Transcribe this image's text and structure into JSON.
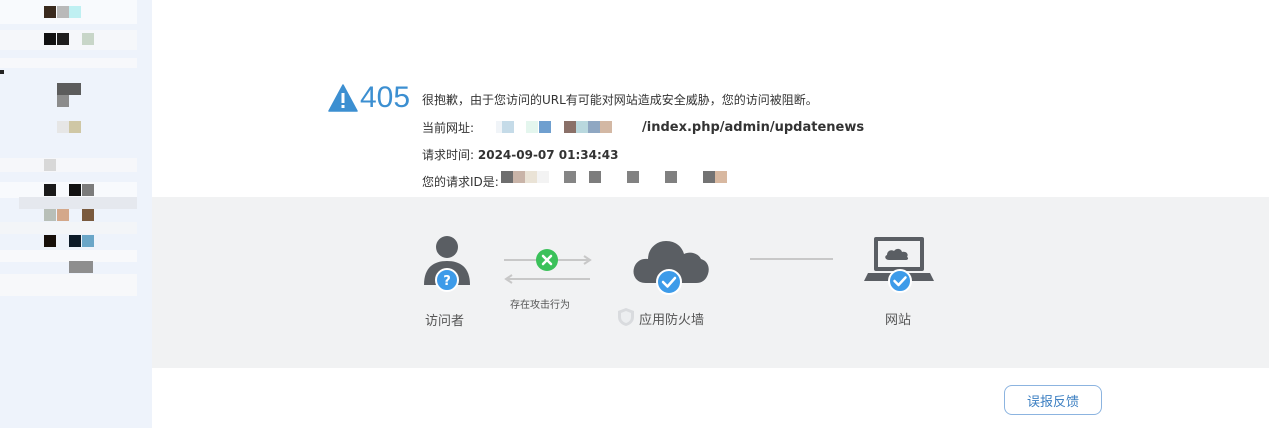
{
  "error": {
    "code": "405",
    "message": "很抱歉，由于您访问的URL有可能对网站造成安全威胁，您的访问被阻断。",
    "url_label": "当前网址:",
    "url_path": "/index.php/admin/updatenews",
    "time_label": "请求时间:",
    "time_value": "2024-09-07 01:34:43",
    "request_id_label": "您的请求ID是:"
  },
  "diagram": {
    "visitor_label": "访问者",
    "attack_label": "存在攻击行为",
    "firewall_label": "应用防火墙",
    "website_label": "网站"
  },
  "buttons": {
    "feedback_label": "误报反馈"
  },
  "colors": {
    "accent_blue": "#3c8fd1",
    "badge_blue": "#3d9be9",
    "attack_green": "#3bc15a",
    "icon_gray": "#5a5e63",
    "band_bg": "#f1f2f3"
  }
}
